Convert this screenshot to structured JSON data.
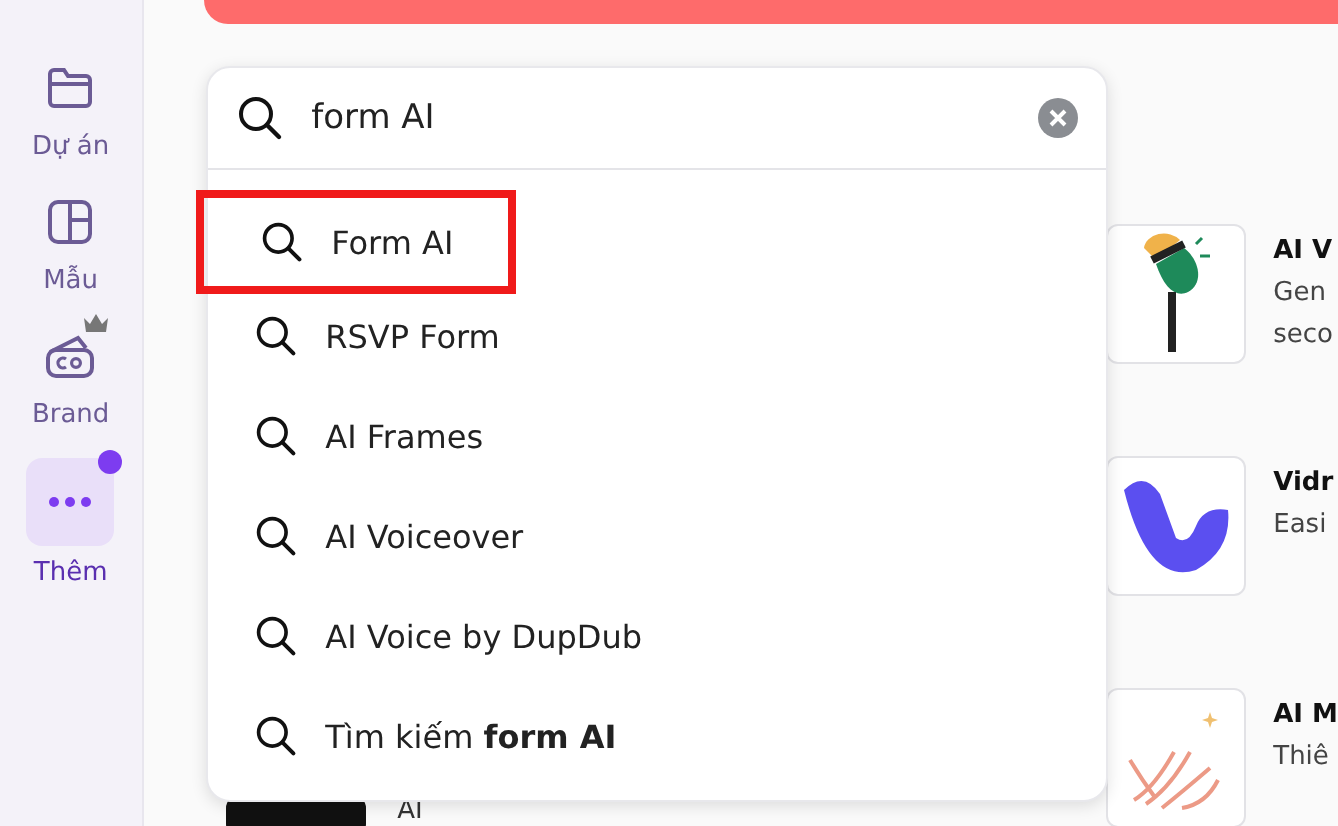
{
  "sidebar": {
    "items": [
      {
        "label": "Dự án",
        "kind": "folder",
        "selected": false,
        "premium": false,
        "notification": false
      },
      {
        "label": "Mẫu",
        "kind": "layout",
        "selected": false,
        "premium": false,
        "notification": false
      },
      {
        "label": "Brand",
        "kind": "brand",
        "selected": false,
        "premium": true,
        "notification": false
      },
      {
        "label": "Thêm",
        "kind": "more",
        "selected": true,
        "premium": false,
        "notification": true
      }
    ]
  },
  "search": {
    "value": "form AI"
  },
  "suggestions": [
    {
      "text": "Form AI",
      "highlighted": true
    },
    {
      "text": "RSVP Form",
      "highlighted": false
    },
    {
      "text": "AI Frames",
      "highlighted": false
    },
    {
      "text": "AI Voiceover",
      "highlighted": false
    },
    {
      "text": "AI Voice by DupDub",
      "highlighted": false
    },
    {
      "text": "Tìm kiếm **form AI**",
      "highlighted": false
    }
  ],
  "apps": [
    {
      "kind": "mic",
      "title": "AI V",
      "lines": [
        "Gen",
        "seco"
      ]
    },
    {
      "kind": "v",
      "title": "Vidr",
      "lines": [
        "Easi"
      ]
    },
    {
      "kind": "hand",
      "title": "AI M",
      "lines": [
        "Thiê"
      ]
    }
  ],
  "below_text": "AI"
}
